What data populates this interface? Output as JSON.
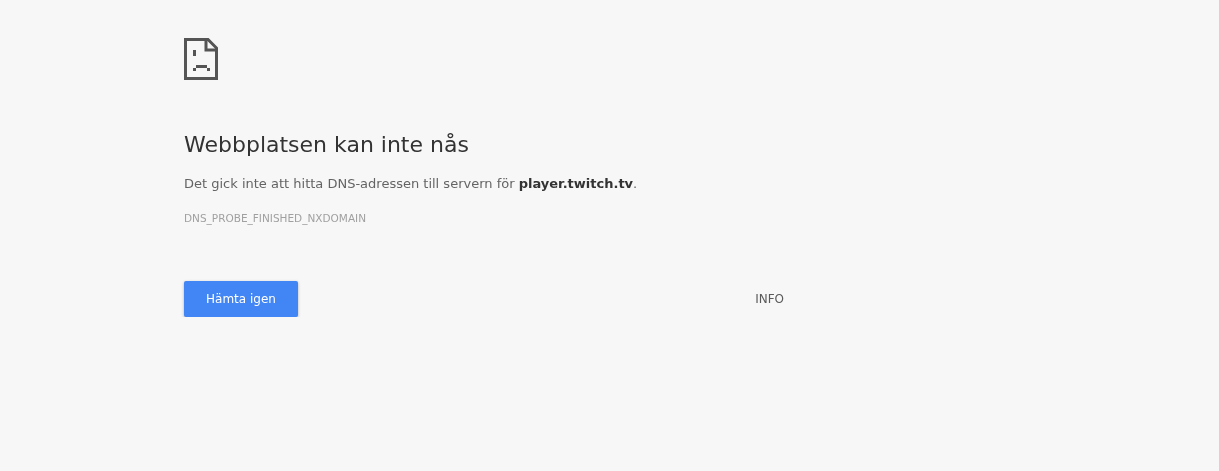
{
  "heading": "Webbplatsen kan inte nås",
  "message": "Det gick inte att hitta DNS-adressen till servern för **player.twitch.tv**.",
  "error_code": "DNS_PROBE_FINISHED_NXDOMAIN",
  "buttons": {
    "reload": "Hämta igen",
    "details": "INFO"
  }
}
